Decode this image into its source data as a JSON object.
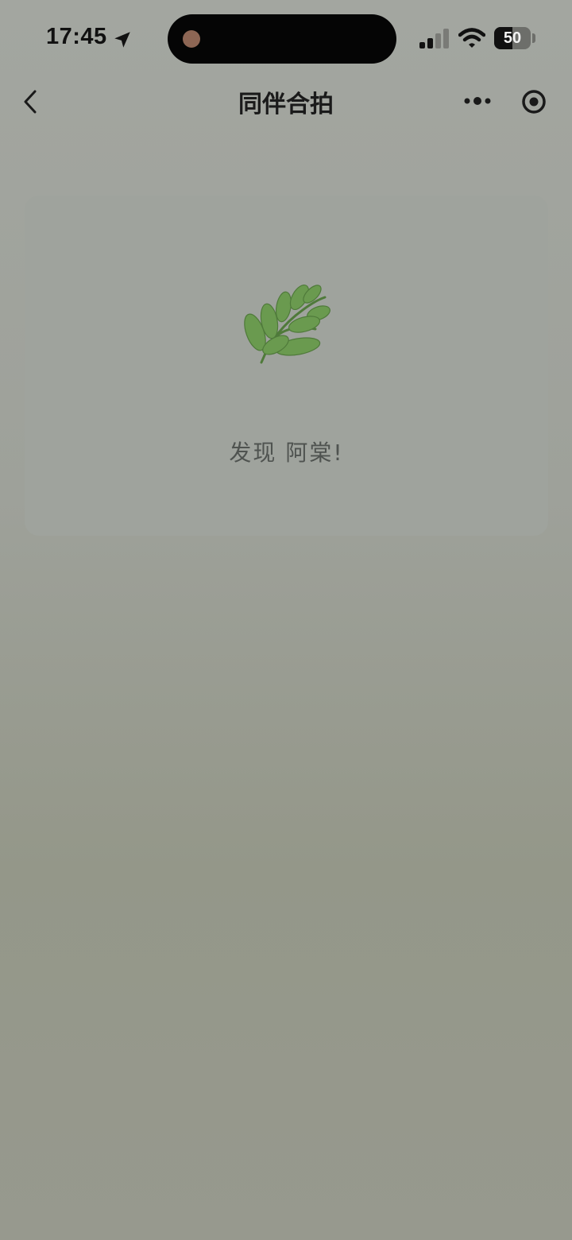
{
  "status_bar": {
    "time": "17:45",
    "battery": "50",
    "battery_level": 0.5
  },
  "nav": {
    "title": "同伴合拍",
    "back_icon": "chevron-left-icon",
    "more_icon": "more-dots-icon",
    "close_icon": "target-close-icon"
  },
  "card": {
    "icon": "leaf-icon",
    "message": "发现 阿棠!"
  },
  "colors": {
    "background": "#a0a39c",
    "card": "#9fa39d",
    "leaf": "#6a9a4f"
  }
}
